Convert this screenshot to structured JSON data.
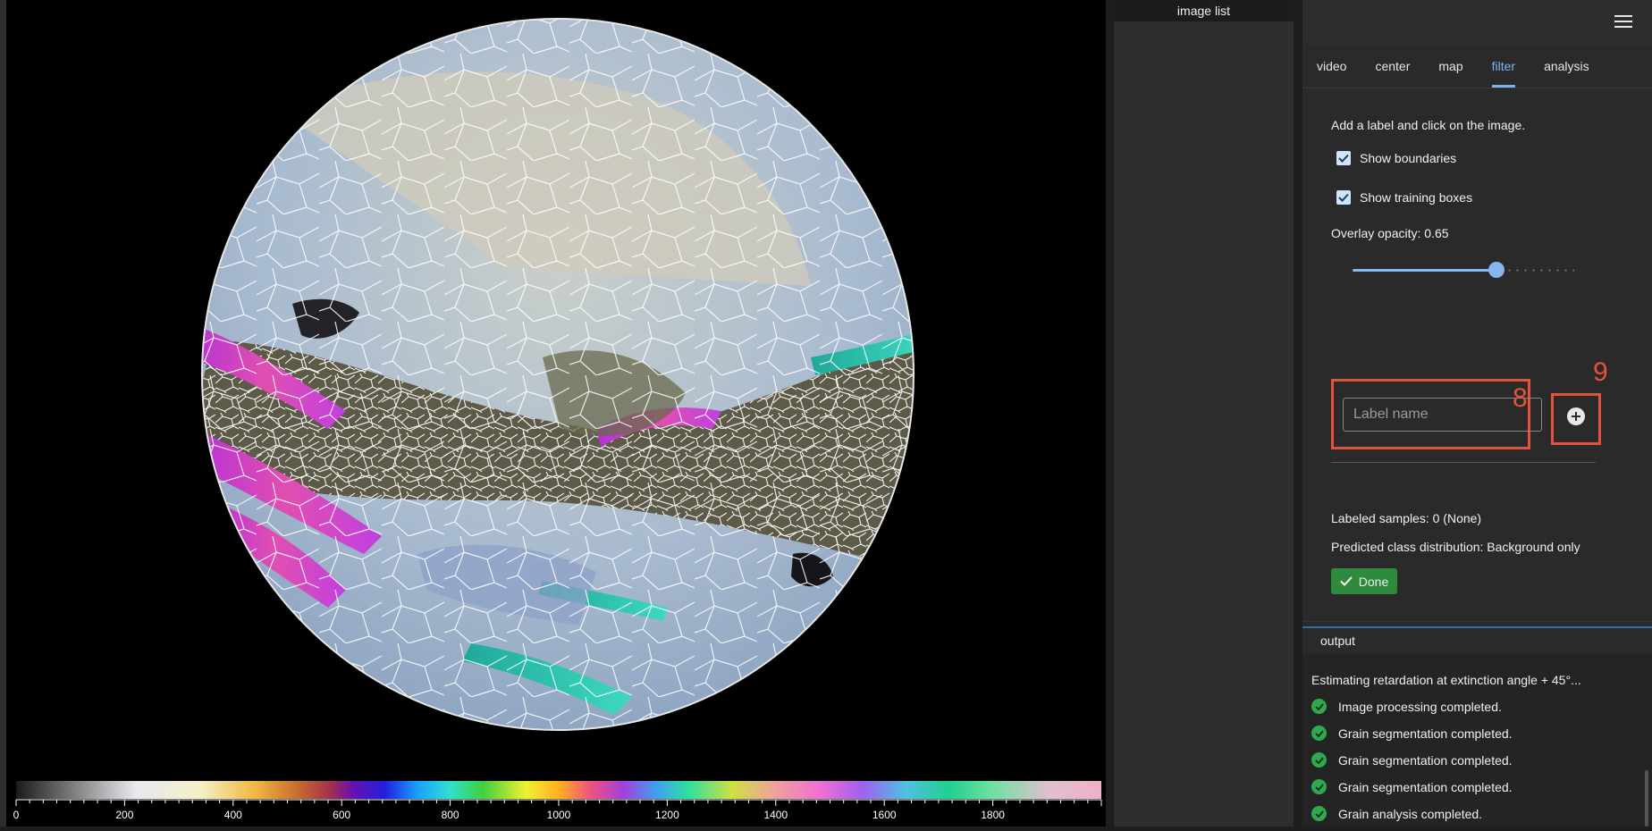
{
  "image_list": {
    "title": "image list"
  },
  "tabs": [
    {
      "label": "video",
      "active": false
    },
    {
      "label": "center",
      "active": false
    },
    {
      "label": "map",
      "active": false
    },
    {
      "label": "filter",
      "active": true
    },
    {
      "label": "analysis",
      "active": false
    }
  ],
  "filter": {
    "hint": "Add a label and click on the image.",
    "show_boundaries": {
      "label": "Show boundaries",
      "checked": true
    },
    "show_training_boxes": {
      "label": "Show training boxes",
      "checked": true
    },
    "opacity_label": "Overlay opacity: 0.65",
    "opacity_value": 0.65,
    "label_input": {
      "placeholder": "Label name",
      "value": ""
    },
    "callout_input": "8",
    "callout_add": "9",
    "labeled_samples": "Labeled samples: 0 (None)",
    "predicted_distribution": "Predicted class distribution: Background only",
    "done_label": "Done"
  },
  "output": {
    "title": "output",
    "status": "Estimating retardation at extinction angle + 45°...",
    "items": [
      "Image processing completed.",
      "Grain segmentation completed.",
      "Grain segmentation completed.",
      "Grain segmentation completed.",
      "Grain analysis completed."
    ]
  },
  "colorbar": {
    "tick_labels": [
      "0",
      "200",
      "400",
      "600",
      "800",
      "1000",
      "1200",
      "1400",
      "1600",
      "1800"
    ],
    "range": [
      0,
      2000
    ]
  },
  "colors": {
    "accent": "#7fb2f0",
    "callout": "#e2533e",
    "done": "#2e8b3d",
    "ok": "#2fa84f"
  }
}
